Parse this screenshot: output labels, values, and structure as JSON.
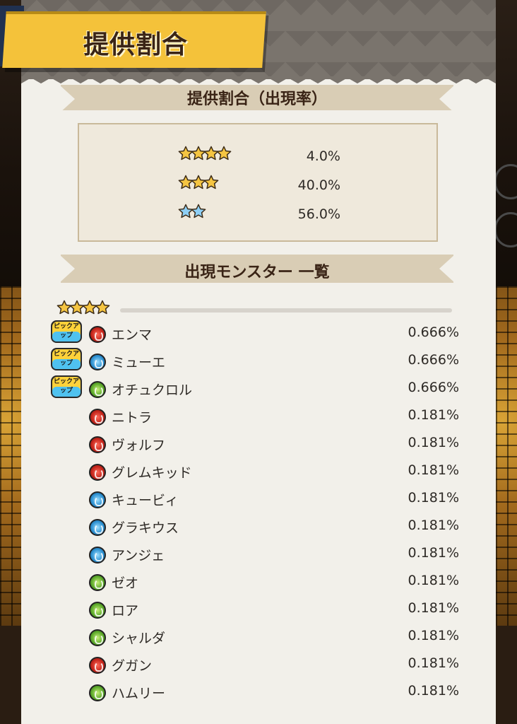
{
  "header": {
    "title": "提供割合"
  },
  "rate_section": {
    "title": "提供割合（出現率）",
    "rows": [
      {
        "stars": 4,
        "star_color": "gold",
        "value": "4.0%"
      },
      {
        "stars": 3,
        "star_color": "gold",
        "value": "40.0%"
      },
      {
        "stars": 2,
        "star_color": "blue",
        "value": "56.0%"
      }
    ]
  },
  "monster_section": {
    "title": "出現モンスター 一覧",
    "tier_stars": 4,
    "pickup_badge": "ピックアップ",
    "monsters": [
      {
        "name": "エンマ",
        "element": "fire",
        "rate": "0.666%",
        "pickup": true
      },
      {
        "name": "ミューエ",
        "element": "water",
        "rate": "0.666%",
        "pickup": true
      },
      {
        "name": "オチュクロル",
        "element": "wood",
        "rate": "0.666%",
        "pickup": true
      },
      {
        "name": "ニトラ",
        "element": "fire",
        "rate": "0.181%",
        "pickup": false
      },
      {
        "name": "ヴォルフ",
        "element": "fire",
        "rate": "0.181%",
        "pickup": false
      },
      {
        "name": "グレムキッド",
        "element": "fire",
        "rate": "0.181%",
        "pickup": false
      },
      {
        "name": "キュービィ",
        "element": "water",
        "rate": "0.181%",
        "pickup": false
      },
      {
        "name": "グラキウス",
        "element": "water",
        "rate": "0.181%",
        "pickup": false
      },
      {
        "name": "アンジェ",
        "element": "water",
        "rate": "0.181%",
        "pickup": false
      },
      {
        "name": "ゼオ",
        "element": "wood",
        "rate": "0.181%",
        "pickup": false
      },
      {
        "name": "ロア",
        "element": "wood",
        "rate": "0.181%",
        "pickup": false
      },
      {
        "name": "シャルダ",
        "element": "wood",
        "rate": "0.181%",
        "pickup": false
      },
      {
        "name": "グガン",
        "element": "fire",
        "rate": "0.181%",
        "pickup": false
      },
      {
        "name": "ハムリー",
        "element": "wood",
        "rate": "0.181%",
        "pickup": false
      }
    ]
  },
  "colors": {
    "gold_star": "#f5c542",
    "blue_star": "#8ecff5",
    "banner": "#f4c23a",
    "text": "#2e2a26"
  }
}
